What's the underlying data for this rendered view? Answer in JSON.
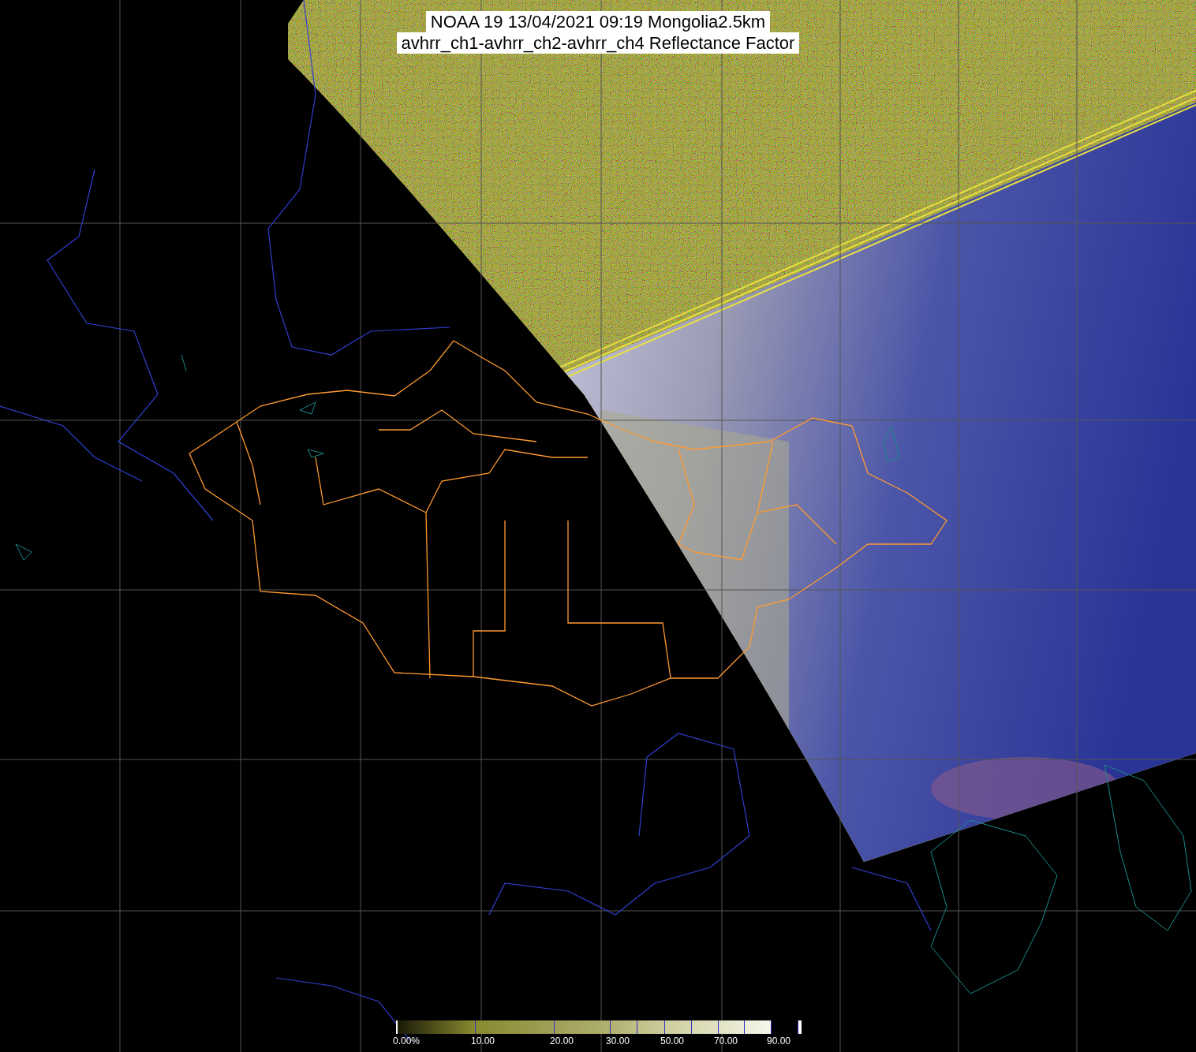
{
  "title": {
    "lines": [
      "NOAA 19 13/04/2021 09:19 Mongolia2.5km",
      "avhrr_ch1-avhrr_ch2-avhrr_ch4 Reflectance Factor"
    ]
  },
  "colorbar": {
    "labels": [
      "0.00%",
      "10.00",
      "20.00",
      "30.00",
      "50.00",
      "70.00",
      "90.00"
    ]
  }
}
